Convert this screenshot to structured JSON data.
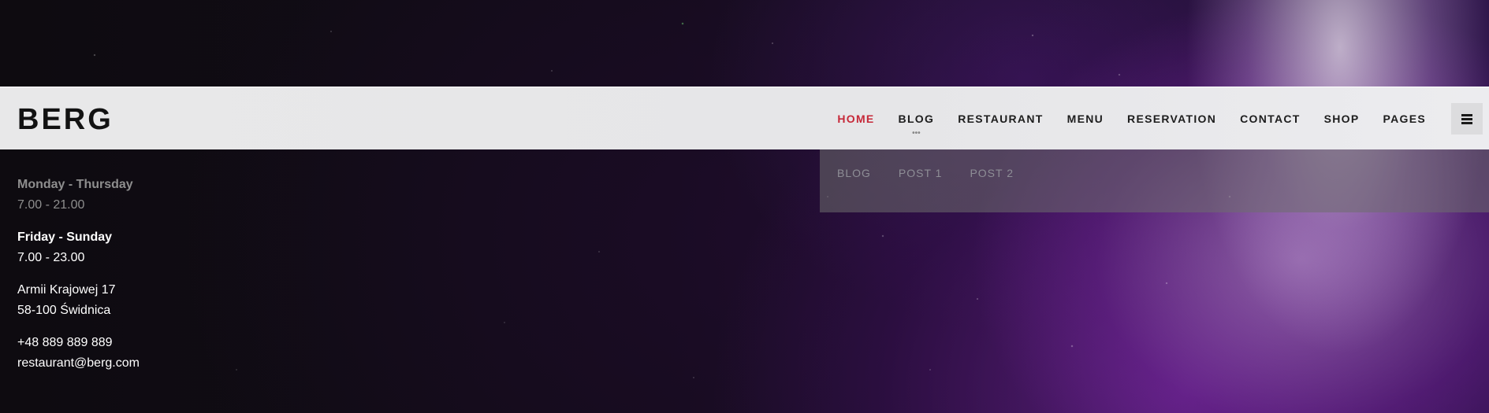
{
  "brand": {
    "logo_text": "BERG"
  },
  "nav": {
    "items": [
      {
        "label": "HOME",
        "active": true
      },
      {
        "label": "BLOG",
        "active": false,
        "has_submenu": true
      },
      {
        "label": "RESTAURANT",
        "active": false
      },
      {
        "label": "MENU",
        "active": false
      },
      {
        "label": "RESERVATION",
        "active": false
      },
      {
        "label": "CONTACT",
        "active": false
      },
      {
        "label": "SHOP",
        "active": false
      },
      {
        "label": "PAGES",
        "active": false
      }
    ],
    "submenu_indicator": "•••",
    "menu_toggle_icon": "hamburger-icon",
    "active_color": "#c62838"
  },
  "submenu": {
    "items": [
      "BLOG",
      "POST 1",
      "POST 2"
    ]
  },
  "info": {
    "hours": [
      {
        "days": "Monday - Thursday",
        "time": "7.00 - 21.00"
      },
      {
        "days": "Friday - Sunday",
        "time": "7.00 - 23.00"
      }
    ],
    "address": {
      "line1": "Armii Krajowej 17",
      "line2": "58-100 Świdnica"
    },
    "phone": "+48 889 889 889",
    "email": "restaurant@berg.com"
  }
}
